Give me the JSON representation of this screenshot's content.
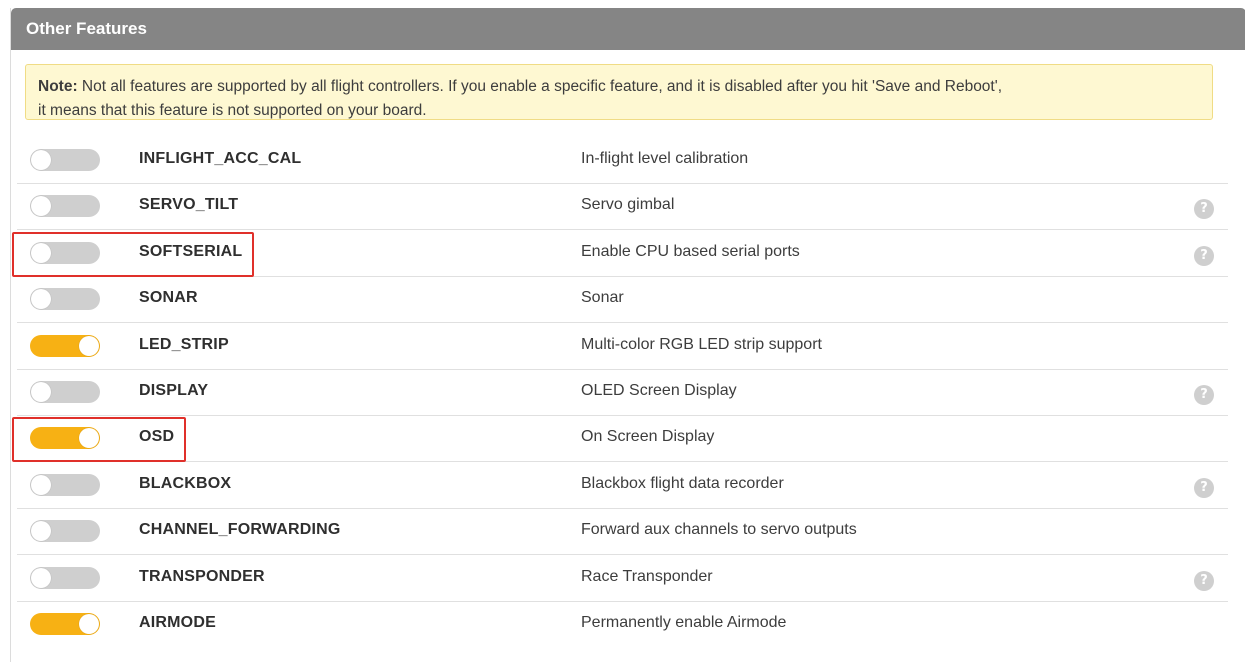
{
  "panel": {
    "title": "Other Features"
  },
  "note": {
    "bold_label": "Note:",
    "line1": " Not all features are supported by all flight controllers. If you enable a specific feature, and it is disabled after you hit 'Save and Reboot',",
    "line2": "it means that this feature is not supported on your board."
  },
  "help_icon_glyph": "?",
  "colors": {
    "toggle_on": "#f7b114",
    "toggle_off": "#cfcfcf",
    "header_bg": "#858585",
    "note_bg": "#fef8d2",
    "highlight": "#e0302a"
  },
  "features": [
    {
      "name": "INFLIGHT_ACC_CAL",
      "description": "In-flight level calibration",
      "enabled": false,
      "has_help": false,
      "highlighted": false
    },
    {
      "name": "SERVO_TILT",
      "description": "Servo gimbal",
      "enabled": false,
      "has_help": true,
      "highlighted": false
    },
    {
      "name": "SOFTSERIAL",
      "description": "Enable CPU based serial ports",
      "enabled": false,
      "has_help": true,
      "highlighted": true
    },
    {
      "name": "SONAR",
      "description": "Sonar",
      "enabled": false,
      "has_help": false,
      "highlighted": false
    },
    {
      "name": "LED_STRIP",
      "description": "Multi-color RGB LED strip support",
      "enabled": true,
      "has_help": false,
      "highlighted": false
    },
    {
      "name": "DISPLAY",
      "description": "OLED Screen Display",
      "enabled": false,
      "has_help": true,
      "highlighted": false
    },
    {
      "name": "OSD",
      "description": "On Screen Display",
      "enabled": true,
      "has_help": false,
      "highlighted": true
    },
    {
      "name": "BLACKBOX",
      "description": "Blackbox flight data recorder",
      "enabled": false,
      "has_help": true,
      "highlighted": false
    },
    {
      "name": "CHANNEL_FORWARDING",
      "description": "Forward aux channels to servo outputs",
      "enabled": false,
      "has_help": false,
      "highlighted": false
    },
    {
      "name": "TRANSPONDER",
      "description": "Race Transponder",
      "enabled": false,
      "has_help": true,
      "highlighted": false
    },
    {
      "name": "AIRMODE",
      "description": "Permanently enable Airmode",
      "enabled": true,
      "has_help": false,
      "highlighted": false
    }
  ]
}
